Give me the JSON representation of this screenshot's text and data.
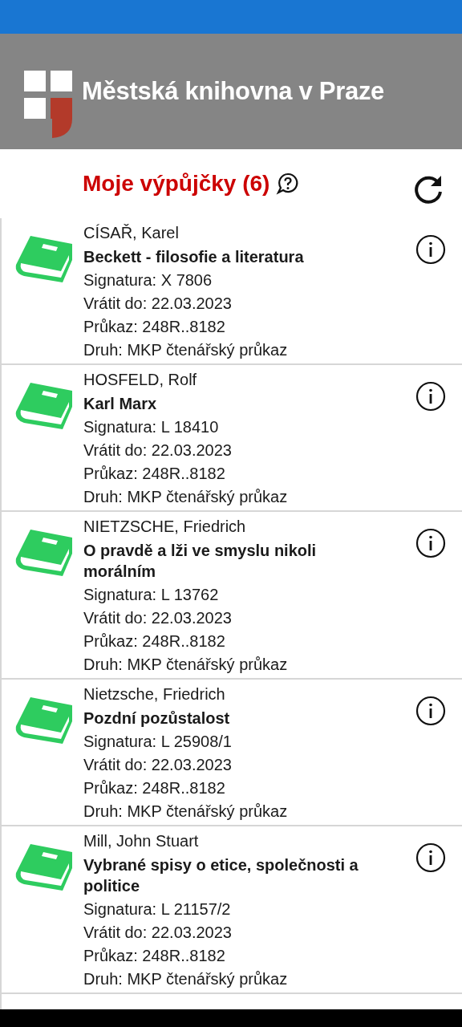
{
  "header": {
    "logo_text": "Městská knihovna v Praze"
  },
  "page_title": "Moje výpůjčky (6)",
  "loans": [
    {
      "author": "CÍSAŘ, Karel",
      "title": "Beckett - filosofie a literatura",
      "signature": "Signatura: X 7806",
      "due": "Vrátit do: 22.03.2023",
      "card": "Průkaz: 248R..8182",
      "card_type": "Druh: MKP čtenářský průkaz"
    },
    {
      "author": "HOSFELD, Rolf",
      "title": "Karl Marx",
      "signature": "Signatura: L 18410",
      "due": "Vrátit do: 22.03.2023",
      "card": "Průkaz: 248R..8182",
      "card_type": "Druh: MKP čtenářský průkaz"
    },
    {
      "author": "NIETZSCHE, Friedrich",
      "title": "O pravdě a lži ve smyslu nikoli morálním",
      "signature": "Signatura: L 13762",
      "due": "Vrátit do: 22.03.2023",
      "card": "Průkaz: 248R..8182",
      "card_type": "Druh: MKP čtenářský průkaz"
    },
    {
      "author": "Nietzsche, Friedrich",
      "title": "Pozdní pozůstalost",
      "signature": "Signatura: L 25908/1",
      "due": "Vrátit do: 22.03.2023",
      "card": "Průkaz: 248R..8182",
      "card_type": "Druh: MKP čtenářský průkaz"
    },
    {
      "author": "Mill, John Stuart",
      "title": "Vybrané spisy o etice, společnosti a politice",
      "signature": "Signatura: L 21157/2",
      "due": "Vrátit do: 22.03.2023",
      "card": "Průkaz: 248R..8182",
      "card_type": "Druh: MKP čtenářský průkaz"
    }
  ]
}
